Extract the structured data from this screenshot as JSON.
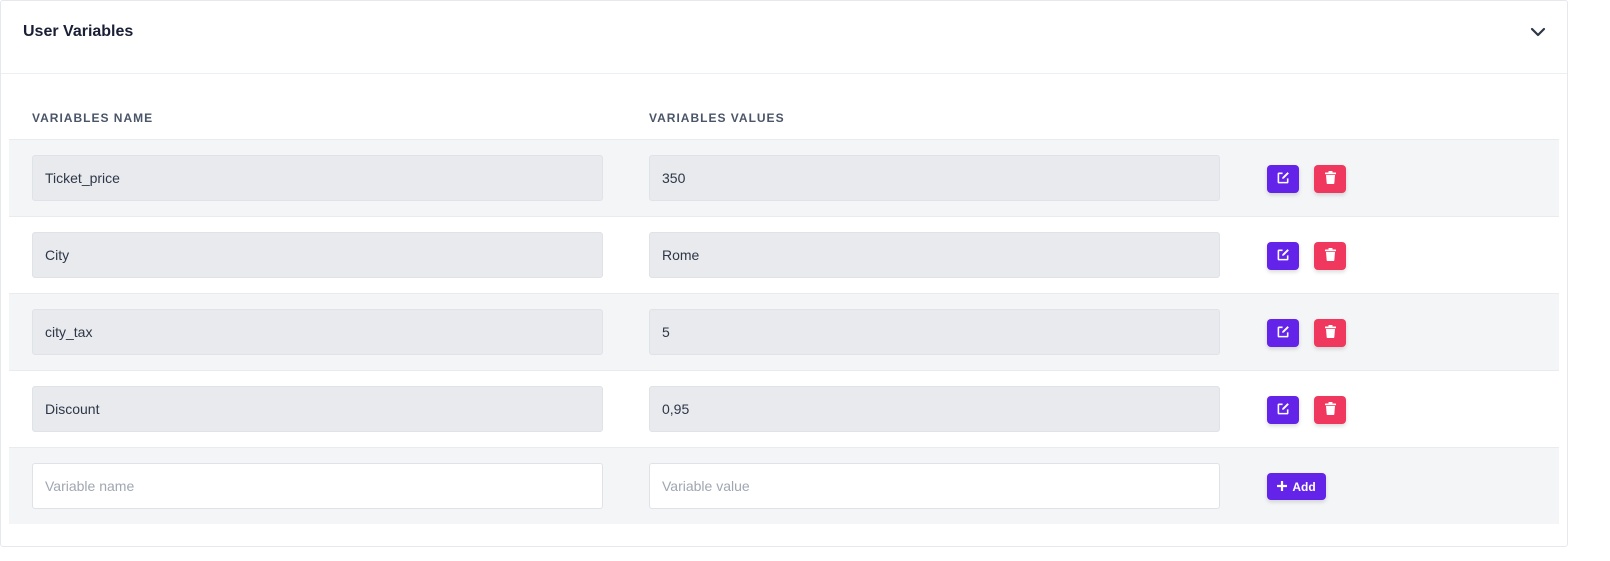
{
  "panel": {
    "title": "User Variables"
  },
  "table": {
    "headers": {
      "name": "VARIABLES NAME",
      "value": "VARIABLES VALUES"
    },
    "rows": [
      {
        "name": "Ticket_price",
        "value": "350"
      },
      {
        "name": "City",
        "value": "Rome"
      },
      {
        "name": "city_tax",
        "value": "5"
      },
      {
        "name": "Discount",
        "value": "0,95"
      }
    ]
  },
  "new_row": {
    "name_placeholder": "Variable name",
    "value_placeholder": "Variable value",
    "add_label": "Add"
  },
  "icons": {
    "collapse": "chevron-down-icon",
    "edit": "edit-icon",
    "delete": "trash-icon",
    "add": "plus-icon"
  },
  "colors": {
    "primary": "#6423e8",
    "danger": "#f0375d",
    "row_alt": "#f4f5f7",
    "field_readonly": "#e8eaed"
  }
}
